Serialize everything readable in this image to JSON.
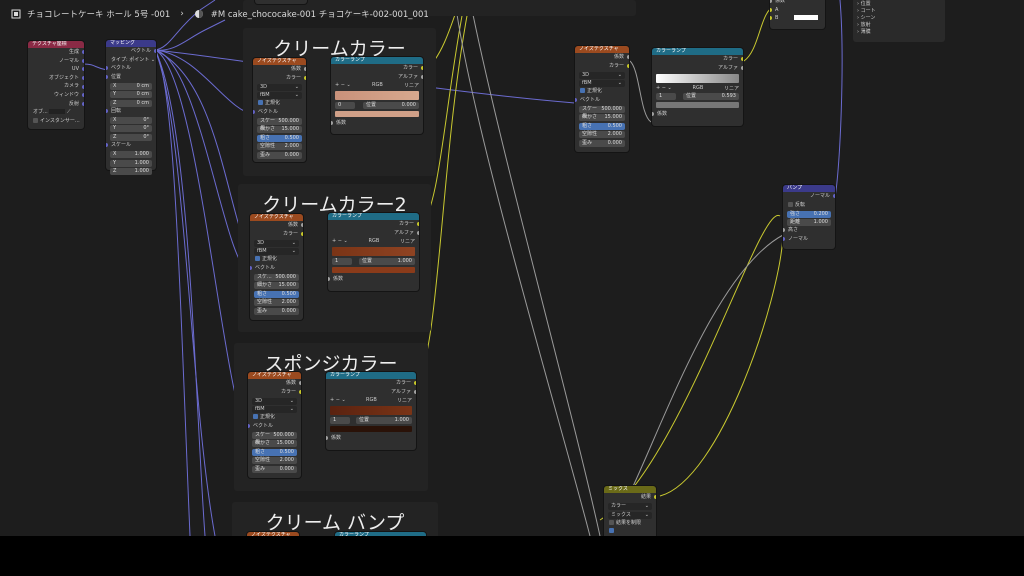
{
  "breadcrumb": {
    "object": "チョコレートケーキ ホール 5号 -001",
    "material": "#M cake_chococake-001 チョコケーキ-002-001_001"
  },
  "frames": {
    "f1": "クリームカラー",
    "f2": "クリームカラー2",
    "f3": "スポンジカラー",
    "f4": "クリーム バンプ"
  },
  "texcoord": {
    "title": "テクスチャ座標",
    "outs": [
      "生成",
      "ノーマル",
      "UV",
      "オブジェクト",
      "カメラ",
      "ウィンドウ",
      "反射"
    ],
    "obj": "オブ...",
    "inst": "インスタンサー..."
  },
  "mapping": {
    "title": "マッピング",
    "out": "ベクトル",
    "type_label": "タイプ:",
    "type_val": "ポイント",
    "vec": "ベクトル",
    "loc": "位置",
    "rot": "回転",
    "scale": "スケール",
    "loc_vals": [
      [
        "X",
        "0 cm"
      ],
      [
        "Y",
        "0 cm"
      ],
      [
        "Z",
        "0 cm"
      ]
    ],
    "rot_vals": [
      [
        "X",
        "0°"
      ],
      [
        "Y",
        "0°"
      ],
      [
        "Z",
        "0°"
      ]
    ],
    "scale_vals": [
      [
        "X",
        "1.000"
      ],
      [
        "Y",
        "1.000"
      ],
      [
        "Z",
        "1.000"
      ]
    ]
  },
  "noise": {
    "title": "ノイズテクスチャ",
    "fac": "係数",
    "color": "カラー",
    "dim": "3D",
    "type": "fBM",
    "norm": "正規化",
    "vec": "ベクトル",
    "fields": [
      [
        "スケール",
        "500.000"
      ],
      [
        "細かさ",
        "15.000"
      ],
      [
        "粗さ",
        "0.500"
      ],
      [
        "空隙性",
        "2.000"
      ],
      [
        "歪み",
        "0.000"
      ]
    ],
    "scale_short": "スケ..."
  },
  "ramp": {
    "title": "カラーランプ",
    "color": "カラー",
    "alpha": "アルファ",
    "mode": "RGB",
    "interp": "リニア",
    "fac": "係数",
    "idx0": "0",
    "idx1": "1",
    "pos": "位置",
    "pos0": "0.000",
    "pos1": "1.000",
    "pos2": "0.593"
  },
  "bump": {
    "title": "バンプ",
    "normal_out": "ノーマル",
    "invert": "反転",
    "strength": "強さ",
    "strength_val": "0.200",
    "distance": "距離",
    "distance_val": "1.000",
    "height": "高さ",
    "normal": "ノーマル"
  },
  "mix": {
    "title": "ミックス",
    "result": "結果",
    "type": "カラー",
    "blend": "ミックス",
    "clamp": "結果を制限"
  },
  "topright": {
    "fac": "係数",
    "a": "A",
    "b": "B"
  },
  "sidelist": [
    "位置",
    "コート",
    "シーン",
    "放射",
    "薄膜"
  ],
  "colors": {
    "bg": "#1d1d1d",
    "yellow": "#c7c729",
    "purple": "#6363c7",
    "gray": "#a1a1a1"
  }
}
